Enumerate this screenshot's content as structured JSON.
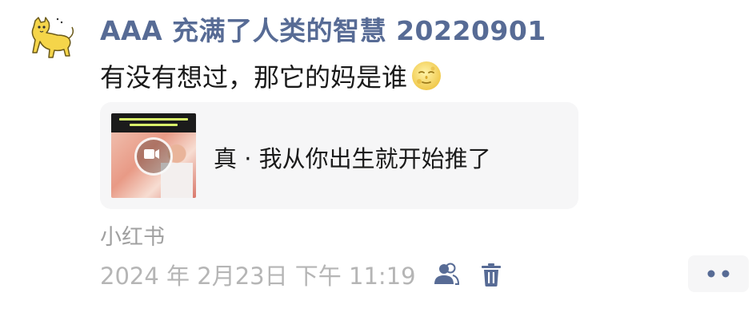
{
  "post": {
    "author": "AAA 充满了人类的智慧 20220901",
    "message": "有没有想过，那它的妈是谁",
    "emoji": "full-moon-face-emoji",
    "link_card": {
      "title": "真 · 我从你出生就开始推了",
      "thumbnail_icon": "video-camera-icon"
    },
    "source": "小红书",
    "timestamp": "2024 年 2月23日 下午 11:19"
  },
  "colors": {
    "author": "#576b95",
    "text": "#1a1a1a",
    "meta": "#b5b5b5",
    "card_bg": "#f6f6f7"
  },
  "icons": {
    "avatar": "yellow-cat-avatar",
    "visibility": "people-icon",
    "delete": "trash-icon",
    "more": "more-dots-icon"
  }
}
